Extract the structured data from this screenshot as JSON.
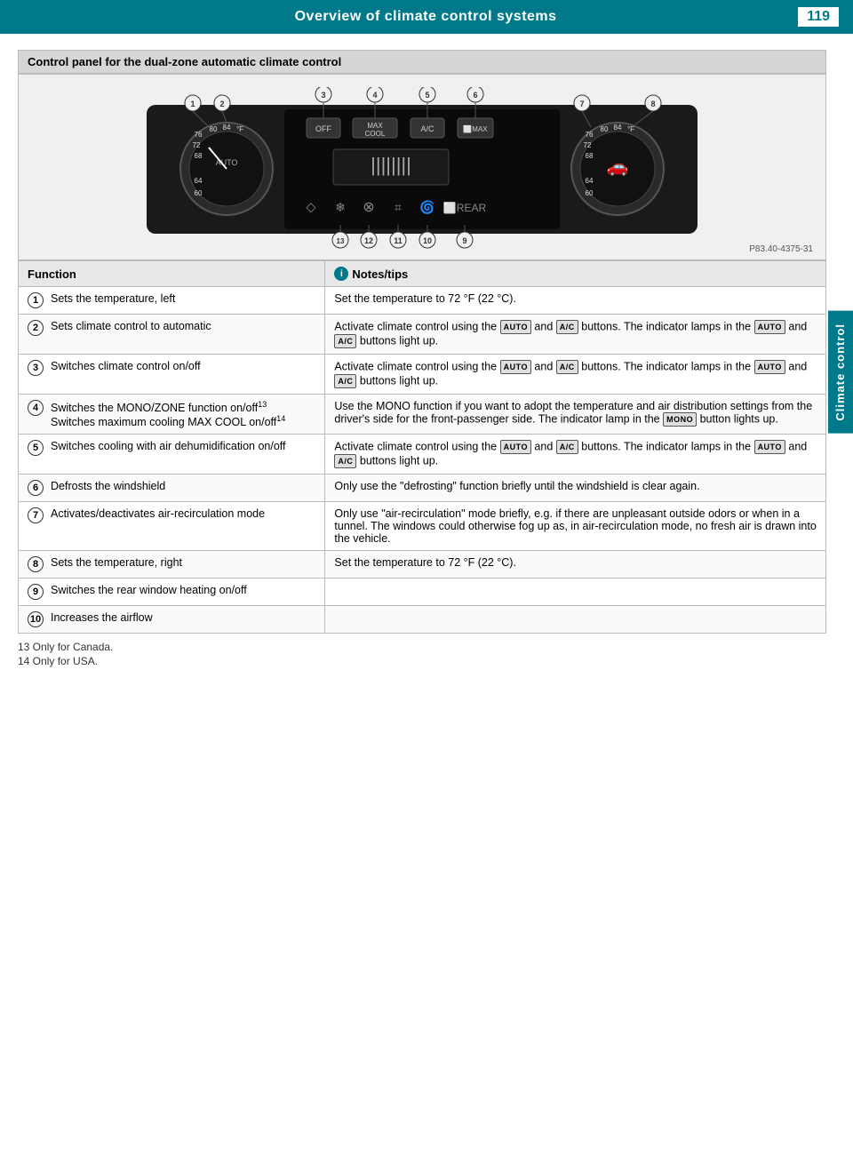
{
  "header": {
    "title": "Overview of climate control systems",
    "page": "119"
  },
  "side_tab": {
    "label": "Climate control"
  },
  "panel_title": "Control panel for the dual-zone automatic climate control",
  "diagram_credit": "P83.40-4375-31",
  "table": {
    "col1": "Function",
    "col2": "Notes/tips",
    "rows": [
      {
        "num": "1",
        "function": "Sets the temperature, left",
        "notes": "Set the temperature to 72 °F (22 °C).",
        "has_buttons": false
      },
      {
        "num": "2",
        "function": "Sets climate control to automatic",
        "notes_pre": "Activate climate control using the",
        "btn1": "AUTO",
        "notes_mid": "and",
        "btn2": "A/C",
        "notes_post": "buttons. The indicator lamps in the",
        "btn3": "AUTO",
        "notes_mid2": "and",
        "btn4": "A/C",
        "notes_end": "buttons light up.",
        "has_buttons": true
      },
      {
        "num": "3",
        "function": "Switches climate control on/off",
        "notes_pre": "Activate climate control using the",
        "btn1": "AUTO",
        "notes_mid": "and",
        "btn2": "A/C",
        "notes_post": "buttons. The indicator lamps in the",
        "btn3": "AUTO",
        "notes_mid2": "and",
        "btn4": "A/C",
        "notes_end": "buttons light up.",
        "has_buttons": true
      },
      {
        "num": "4",
        "function_line1": "Switches the MONO/ZONE function on/off",
        "sup1": "13",
        "function_line2": "Switches maximum cooling MAX COOL on/off",
        "sup2": "14",
        "notes": "Use the MONO function if you want to adopt the temperature and air distribution settings from the driver's side for the front-passenger side. The indicator lamp in the",
        "btn_mono": "MONO",
        "notes_end": "button lights up.",
        "has_buttons": true,
        "is_mono": true
      },
      {
        "num": "5",
        "function": "Switches cooling with air dehumidification on/off",
        "notes_pre": "Activate climate control using the",
        "btn1": "AUTO",
        "notes_mid": "and",
        "btn2": "A/C",
        "notes_post": "buttons. The indicator lamps in the",
        "btn3": "AUTO",
        "notes_mid2": "and",
        "btn4": "A/C",
        "notes_end": "buttons light up.",
        "has_buttons": true
      },
      {
        "num": "6",
        "function": "Defrosts the windshield",
        "notes": "Only use the \"defrosting\" function briefly until the windshield is clear again.",
        "has_buttons": false
      },
      {
        "num": "7",
        "function": "Activates/deactivates air-recirculation mode",
        "notes": "Only use \"air-recirculation\" mode briefly, e.g. if there are unpleasant outside odors or when in a tunnel. The windows could otherwise fog up as, in air-recirculation mode, no fresh air is drawn into the vehicle.",
        "has_buttons": false
      },
      {
        "num": "8",
        "function": "Sets the temperature, right",
        "notes": "Set the temperature to 72 °F (22 °C).",
        "has_buttons": false
      },
      {
        "num": "9",
        "function": "Switches the rear window heating on/off",
        "notes": "",
        "has_buttons": false
      },
      {
        "num": "10",
        "function": "Increases the airflow",
        "notes": "",
        "has_buttons": false
      }
    ]
  },
  "footnotes": [
    "13 Only for Canada.",
    "14 Only for USA."
  ]
}
